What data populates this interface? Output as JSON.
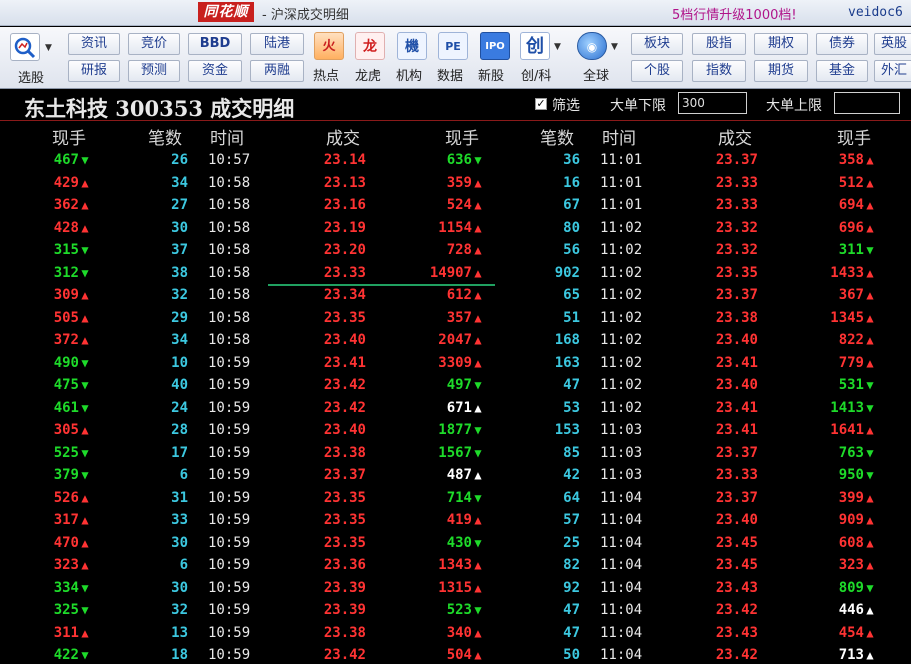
{
  "titlebar": {
    "brand": "同花顺",
    "title": "- 沪深成交明细",
    "promo": "5档行情升级1000档!",
    "user": "veidoc6"
  },
  "toolbar": {
    "select_label": "选股",
    "small_buttons": [
      {
        "top": "资讯",
        "bottom": "研报"
      },
      {
        "top": "竞价",
        "bottom": "预测"
      },
      {
        "top": "BBD",
        "bottom": "资金"
      },
      {
        "top": "陆港",
        "bottom": "两融"
      }
    ],
    "big_buttons": [
      {
        "icon": "hot-icon",
        "glyph": "火",
        "label": "热点"
      },
      {
        "icon": "dragon-tiger-icon",
        "glyph": "龙",
        "label": "龙虎"
      },
      {
        "icon": "institution-icon",
        "glyph": "机",
        "label": "机构"
      },
      {
        "icon": "pe-data-icon",
        "glyph": "PE",
        "label": "数据"
      },
      {
        "icon": "ipo-icon",
        "glyph": "IPO",
        "label": "新股"
      },
      {
        "icon": "chuang-icon",
        "glyph": "创",
        "label": "创/科"
      },
      {
        "icon": "globe-icon",
        "glyph": "◉",
        "label": "全球"
      }
    ],
    "right_buttons": [
      {
        "top": "板块",
        "bottom": "个股"
      },
      {
        "top": "股指",
        "bottom": "指数"
      },
      {
        "top": "期权",
        "bottom": "期货"
      },
      {
        "top": "债券",
        "bottom": "基金"
      },
      {
        "top": "英股",
        "bottom": "外汇"
      }
    ]
  },
  "header": {
    "stock_title": "东土科技 300353 成交明细",
    "filter_checked": true,
    "filter_label": "筛选",
    "lower_limit_label": "大单下限",
    "lower_limit_value": "300",
    "upper_limit_label": "大单上限",
    "upper_limit_value": ""
  },
  "columns": {
    "vol_a": "现手",
    "cnt_a": "笔数",
    "time": "时间",
    "price": "成交",
    "vol": "现手"
  },
  "colors": {
    "up": "#ff3333",
    "down": "#1edb2a",
    "neutral": "#ffffff",
    "count": "#3cc8e0"
  },
  "trades": [
    {
      "l": {
        "v": "467",
        "d": "dn",
        "n": "26",
        "t": "10:57",
        "p": "23.14",
        "pd": "up"
      },
      "m": {
        "v": "636",
        "d": "dn",
        "n": "36",
        "t": "11:01",
        "p": "23.37",
        "pd": "up"
      },
      "r": {
        "v": "358",
        "d": "up"
      }
    },
    {
      "l": {
        "v": "429",
        "d": "up",
        "n": "34",
        "t": "10:58",
        "p": "23.13",
        "pd": "up"
      },
      "m": {
        "v": "359",
        "d": "up",
        "n": "16",
        "t": "11:01",
        "p": "23.33",
        "pd": "up"
      },
      "r": {
        "v": "512",
        "d": "up"
      }
    },
    {
      "l": {
        "v": "362",
        "d": "up",
        "n": "27",
        "t": "10:58",
        "p": "23.16",
        "pd": "up"
      },
      "m": {
        "v": "524",
        "d": "up",
        "n": "67",
        "t": "11:01",
        "p": "23.33",
        "pd": "up"
      },
      "r": {
        "v": "694",
        "d": "up"
      }
    },
    {
      "l": {
        "v": "428",
        "d": "up",
        "n": "30",
        "t": "10:58",
        "p": "23.19",
        "pd": "up"
      },
      "m": {
        "v": "1154",
        "d": "up",
        "n": "80",
        "t": "11:02",
        "p": "23.32",
        "pd": "up"
      },
      "r": {
        "v": "696",
        "d": "up"
      }
    },
    {
      "l": {
        "v": "315",
        "d": "dn",
        "n": "37",
        "t": "10:58",
        "p": "23.20",
        "pd": "up"
      },
      "m": {
        "v": "728",
        "d": "up",
        "n": "56",
        "t": "11:02",
        "p": "23.32",
        "pd": "up"
      },
      "r": {
        "v": "311",
        "d": "dn"
      }
    },
    {
      "l": {
        "v": "312",
        "d": "dn",
        "n": "38",
        "t": "10:58",
        "p": "23.33",
        "pd": "up"
      },
      "m": {
        "v": "14907",
        "d": "up",
        "n": "902",
        "t": "11:02",
        "p": "23.35",
        "pd": "up"
      },
      "r": {
        "v": "1433",
        "d": "up"
      }
    },
    {
      "l": {
        "v": "309",
        "d": "up",
        "n": "32",
        "t": "10:58",
        "p": "23.34",
        "pd": "up"
      },
      "m": {
        "v": "612",
        "d": "up",
        "n": "65",
        "t": "11:02",
        "p": "23.37",
        "pd": "up"
      },
      "r": {
        "v": "367",
        "d": "up"
      }
    },
    {
      "l": {
        "v": "505",
        "d": "up",
        "n": "29",
        "t": "10:58",
        "p": "23.35",
        "pd": "up"
      },
      "m": {
        "v": "357",
        "d": "up",
        "n": "51",
        "t": "11:02",
        "p": "23.38",
        "pd": "up"
      },
      "r": {
        "v": "1345",
        "d": "up"
      }
    },
    {
      "l": {
        "v": "372",
        "d": "up",
        "n": "34",
        "t": "10:58",
        "p": "23.40",
        "pd": "up"
      },
      "m": {
        "v": "2047",
        "d": "up",
        "n": "168",
        "t": "11:02",
        "p": "23.40",
        "pd": "up"
      },
      "r": {
        "v": "822",
        "d": "up"
      }
    },
    {
      "l": {
        "v": "490",
        "d": "dn",
        "n": "10",
        "t": "10:59",
        "p": "23.41",
        "pd": "up"
      },
      "m": {
        "v": "3309",
        "d": "up",
        "n": "163",
        "t": "11:02",
        "p": "23.41",
        "pd": "up"
      },
      "r": {
        "v": "779",
        "d": "up"
      }
    },
    {
      "l": {
        "v": "475",
        "d": "dn",
        "n": "40",
        "t": "10:59",
        "p": "23.42",
        "pd": "up"
      },
      "m": {
        "v": "497",
        "d": "dn",
        "n": "47",
        "t": "11:02",
        "p": "23.40",
        "pd": "up"
      },
      "r": {
        "v": "531",
        "d": "dn"
      }
    },
    {
      "l": {
        "v": "461",
        "d": "dn",
        "n": "24",
        "t": "10:59",
        "p": "23.42",
        "pd": "up"
      },
      "m": {
        "v": "671",
        "d": "neu",
        "n": "53",
        "t": "11:02",
        "p": "23.41",
        "pd": "up"
      },
      "r": {
        "v": "1413",
        "d": "dn"
      }
    },
    {
      "l": {
        "v": "305",
        "d": "up",
        "n": "28",
        "t": "10:59",
        "p": "23.40",
        "pd": "up"
      },
      "m": {
        "v": "1877",
        "d": "dn",
        "n": "153",
        "t": "11:03",
        "p": "23.41",
        "pd": "up"
      },
      "r": {
        "v": "1641",
        "d": "up"
      }
    },
    {
      "l": {
        "v": "525",
        "d": "dn",
        "n": "17",
        "t": "10:59",
        "p": "23.38",
        "pd": "up"
      },
      "m": {
        "v": "1567",
        "d": "dn",
        "n": "85",
        "t": "11:03",
        "p": "23.37",
        "pd": "up"
      },
      "r": {
        "v": "763",
        "d": "dn"
      }
    },
    {
      "l": {
        "v": "379",
        "d": "dn",
        "n": "6",
        "t": "10:59",
        "p": "23.37",
        "pd": "up"
      },
      "m": {
        "v": "487",
        "d": "neu",
        "n": "42",
        "t": "11:03",
        "p": "23.33",
        "pd": "up"
      },
      "r": {
        "v": "950",
        "d": "dn"
      }
    },
    {
      "l": {
        "v": "526",
        "d": "up",
        "n": "31",
        "t": "10:59",
        "p": "23.35",
        "pd": "up"
      },
      "m": {
        "v": "714",
        "d": "dn",
        "n": "64",
        "t": "11:04",
        "p": "23.37",
        "pd": "up"
      },
      "r": {
        "v": "399",
        "d": "up"
      }
    },
    {
      "l": {
        "v": "317",
        "d": "up",
        "n": "33",
        "t": "10:59",
        "p": "23.35",
        "pd": "up"
      },
      "m": {
        "v": "419",
        "d": "up",
        "n": "57",
        "t": "11:04",
        "p": "23.40",
        "pd": "up"
      },
      "r": {
        "v": "909",
        "d": "up"
      }
    },
    {
      "l": {
        "v": "470",
        "d": "up",
        "n": "30",
        "t": "10:59",
        "p": "23.35",
        "pd": "up"
      },
      "m": {
        "v": "430",
        "d": "dn",
        "n": "25",
        "t": "11:04",
        "p": "23.45",
        "pd": "up"
      },
      "r": {
        "v": "608",
        "d": "up"
      }
    },
    {
      "l": {
        "v": "323",
        "d": "up",
        "n": "6",
        "t": "10:59",
        "p": "23.36",
        "pd": "up"
      },
      "m": {
        "v": "1343",
        "d": "up",
        "n": "82",
        "t": "11:04",
        "p": "23.45",
        "pd": "up"
      },
      "r": {
        "v": "323",
        "d": "up"
      }
    },
    {
      "l": {
        "v": "334",
        "d": "dn",
        "n": "30",
        "t": "10:59",
        "p": "23.39",
        "pd": "up"
      },
      "m": {
        "v": "1315",
        "d": "up",
        "n": "92",
        "t": "11:04",
        "p": "23.43",
        "pd": "up"
      },
      "r": {
        "v": "809",
        "d": "dn"
      }
    },
    {
      "l": {
        "v": "325",
        "d": "dn",
        "n": "32",
        "t": "10:59",
        "p": "23.39",
        "pd": "up"
      },
      "m": {
        "v": "523",
        "d": "dn",
        "n": "47",
        "t": "11:04",
        "p": "23.42",
        "pd": "up"
      },
      "r": {
        "v": "446",
        "d": "neu"
      }
    },
    {
      "l": {
        "v": "311",
        "d": "up",
        "n": "13",
        "t": "10:59",
        "p": "23.38",
        "pd": "up"
      },
      "m": {
        "v": "340",
        "d": "up",
        "n": "47",
        "t": "11:04",
        "p": "23.43",
        "pd": "up"
      },
      "r": {
        "v": "454",
        "d": "up"
      }
    },
    {
      "l": {
        "v": "422",
        "d": "dn",
        "n": "18",
        "t": "10:59",
        "p": "23.42",
        "pd": "up"
      },
      "m": {
        "v": "504",
        "d": "up",
        "n": "50",
        "t": "11:04",
        "p": "23.42",
        "pd": "up"
      },
      "r": {
        "v": "713",
        "d": "neu"
      }
    }
  ]
}
